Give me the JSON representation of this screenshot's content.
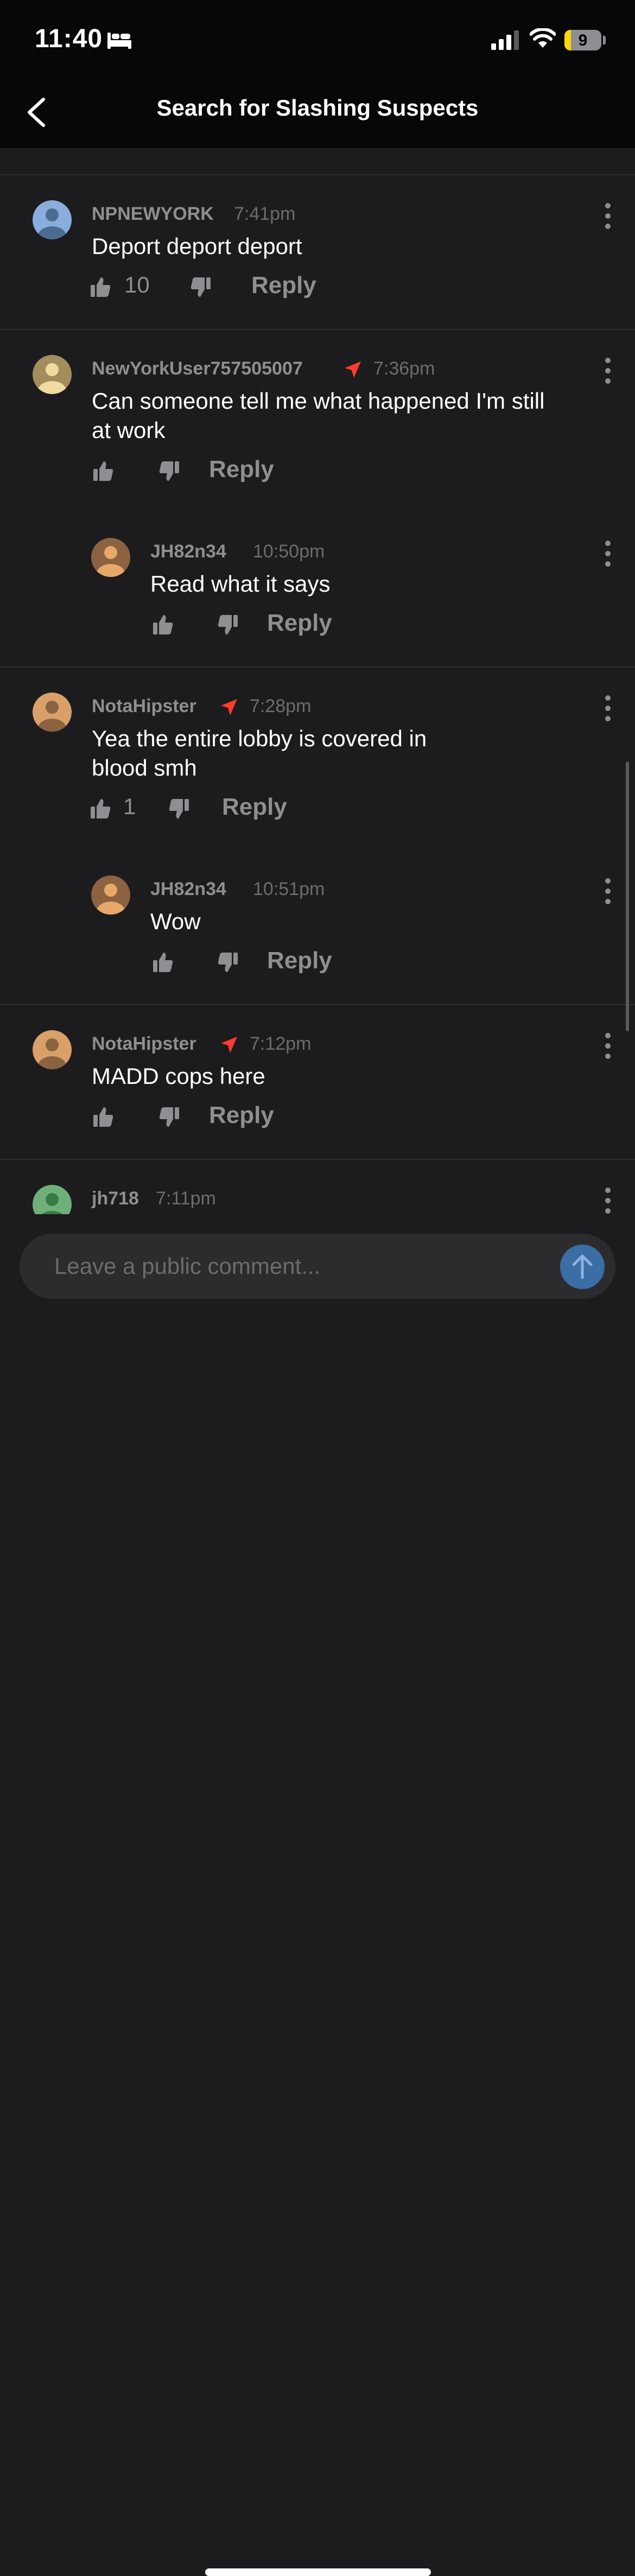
{
  "status_bar": {
    "time": "11:40",
    "battery": "9"
  },
  "nav": {
    "title": "Search for Slashing Suspects"
  },
  "comments": [
    {
      "user": "NPNEWYORK",
      "time": "7:41pm",
      "text": "Deport deport deport",
      "likes": "10",
      "reply": "Reply"
    },
    {
      "user": "NewYorkUser757505007",
      "time": "7:36pm",
      "text": "Can someone tell me what happened I'm still at work",
      "likes": "",
      "reply": "Reply"
    },
    {
      "user": "JH82n34",
      "time": "10:50pm",
      "text": "Read what it says",
      "likes": "",
      "reply": "Reply"
    },
    {
      "user": "NotaHipster",
      "time": "7:28pm",
      "text": "Yea the entire lobby is covered in blood smh",
      "likes": "1",
      "reply": "Reply"
    },
    {
      "user": "JH82n34",
      "time": "10:51pm",
      "text": "Wow",
      "likes": "",
      "reply": "Reply"
    },
    {
      "user": "NotaHipster",
      "time": "7:12pm",
      "text": "MADD cops here",
      "likes": "",
      "reply": "Reply"
    },
    {
      "user": "jh718",
      "time": "7:11pm"
    }
  ],
  "composer": {
    "placeholder": "Leave a public comment..."
  },
  "colors": {
    "location_arrow": "#ff3b30",
    "send_button": "#3a6ea5"
  }
}
